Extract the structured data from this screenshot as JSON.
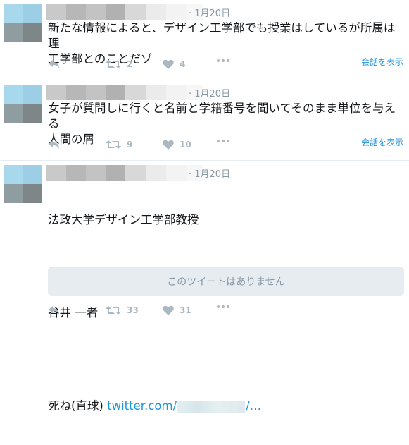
{
  "tweets": [
    {
      "time": "· 1月20日",
      "text": "新たな情報によると、デザイン工学部でも授業はしているが所属は理\n工学部とのことだゾ",
      "show_conversation": "会話を表示",
      "retweets": "2",
      "likes": "4"
    },
    {
      "time": "· 1月20日",
      "text": "女子が質問しに行くと名前と学籍番号を聞いてそのまま単位を与える\n人間の屑",
      "show_conversation": "会話を表示",
      "retweets": "9",
      "likes": "10"
    },
    {
      "time": "· 1月20日",
      "line1": "法政大学デザイン工学部教授",
      "line2": "谷井 一者",
      "line3_prefix": "死ね(直球) ",
      "link_text": "twitter.com/",
      "link_suffix": "/…",
      "unavailable_text": "このツイートはありません",
      "retweets": "33",
      "likes": "31"
    }
  ],
  "icons": {
    "reply": "reply-icon",
    "retweet": "retweet-icon",
    "like": "heart-icon",
    "more": "more-dots-icon"
  },
  "colors": {
    "link": "#1b95e0",
    "icon": "#aab8c2",
    "meta": "#8899a6",
    "card_bg": "#e6ecf0"
  }
}
